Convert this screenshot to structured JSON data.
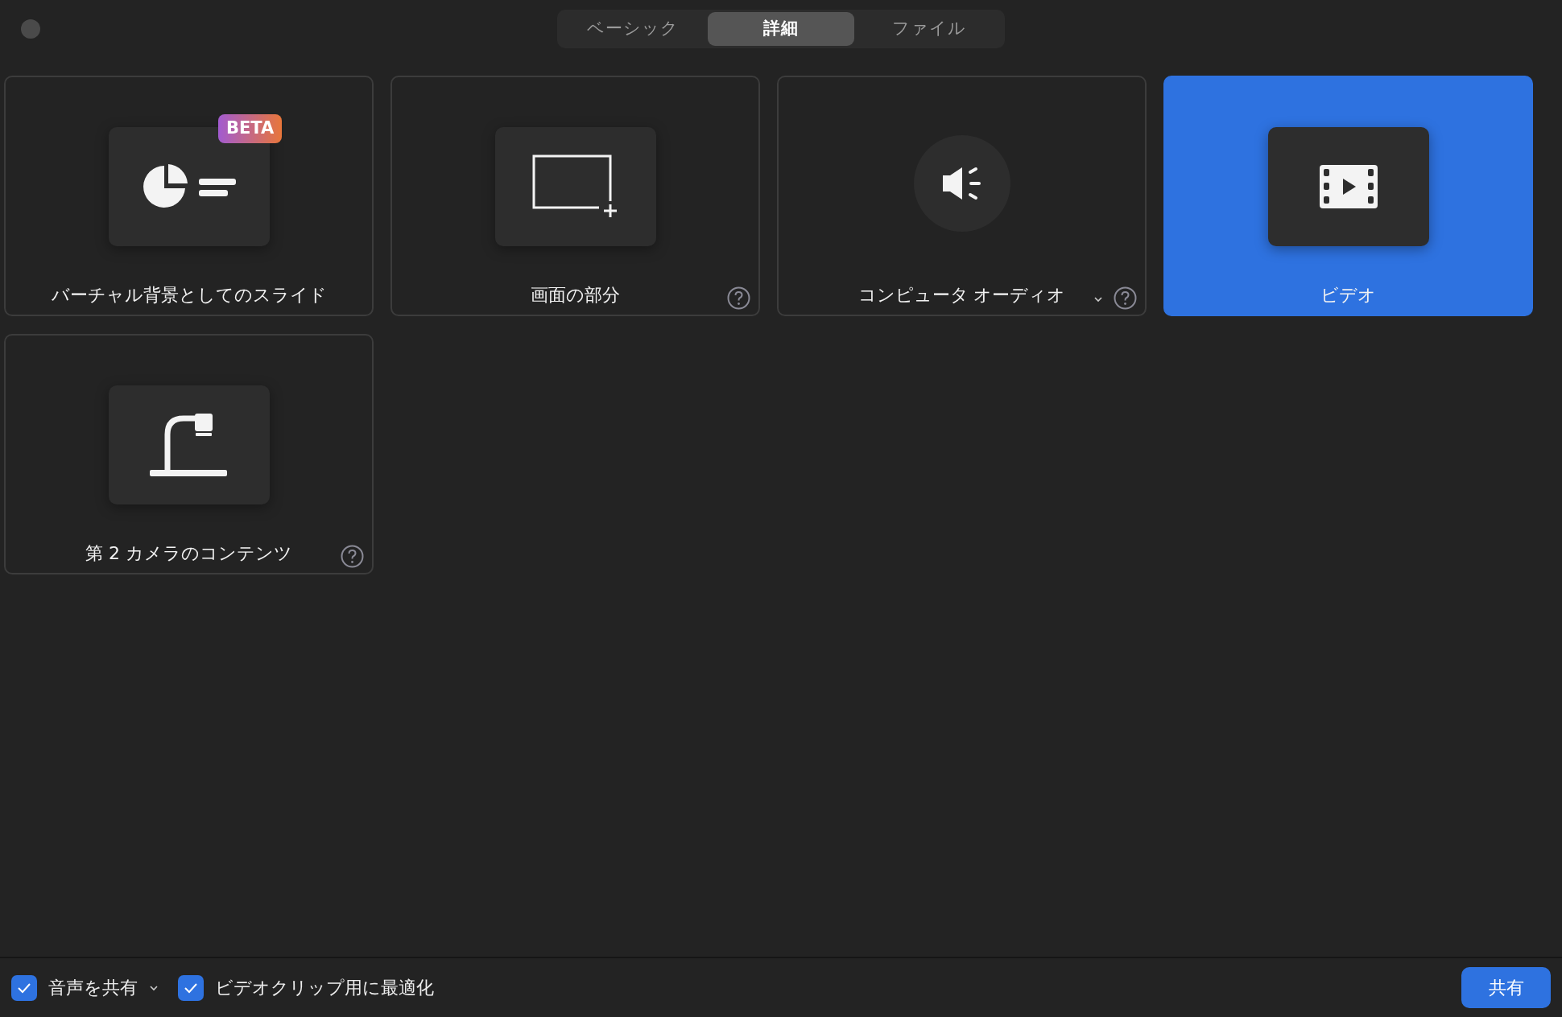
{
  "tabs": [
    {
      "label": "ベーシック",
      "selected": false
    },
    {
      "label": "詳細",
      "selected": true
    },
    {
      "label": "ファイル",
      "selected": false
    }
  ],
  "cards": [
    {
      "kind": "slides",
      "label": "バーチャル背景としてのスライド",
      "selected": false,
      "badge": "BETA",
      "help": false,
      "dropdown": false
    },
    {
      "kind": "portion",
      "label": "画面の部分",
      "selected": false,
      "help": true,
      "dropdown": false
    },
    {
      "kind": "audio",
      "label": "コンピュータ オーディオ",
      "selected": false,
      "help": true,
      "dropdown": true
    },
    {
      "kind": "video",
      "label": "ビデオ",
      "selected": true,
      "help": false,
      "dropdown": false
    },
    {
      "kind": "camera",
      "label": "第 2 カメラのコンテンツ",
      "selected": false,
      "help": true,
      "dropdown": false
    }
  ],
  "options": [
    {
      "label": "音声を共有",
      "checked": true,
      "dropdown": true
    },
    {
      "label": "ビデオクリップ用に最適化",
      "checked": true,
      "dropdown": false
    }
  ],
  "share_button": "共有"
}
